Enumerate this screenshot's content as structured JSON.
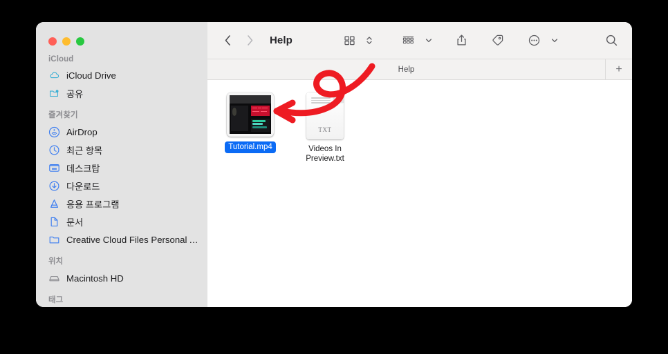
{
  "window": {
    "title": "Help",
    "traffic_lights": [
      "close",
      "minimize",
      "maximize"
    ]
  },
  "sidebar": {
    "sections": [
      {
        "title": "iCloud",
        "items": [
          {
            "label": "iCloud Drive",
            "icon": "icloud-drive-icon"
          },
          {
            "label": "공유",
            "icon": "shared-folder-icon"
          }
        ]
      },
      {
        "title": "즐겨찾기",
        "items": [
          {
            "label": "AirDrop",
            "icon": "airdrop-icon"
          },
          {
            "label": "최근 항목",
            "icon": "recents-clock-icon"
          },
          {
            "label": "데스크탑",
            "icon": "desktop-icon"
          },
          {
            "label": "다운로드",
            "icon": "downloads-icon"
          },
          {
            "label": "응용 프로그램",
            "icon": "applications-icon"
          },
          {
            "label": "문서",
            "icon": "documents-icon"
          },
          {
            "label": "Creative Cloud Files Personal A...",
            "icon": "folder-icon"
          }
        ]
      },
      {
        "title": "위치",
        "items": [
          {
            "label": "Macintosh HD",
            "icon": "hard-disk-icon"
          }
        ]
      }
    ],
    "cut_off_section_title": "태그"
  },
  "toolbar": {
    "back_icon": "chevron-left-icon",
    "forward_icon": "chevron-right-icon",
    "folder_title": "Help",
    "view_icon": "icon-view-grid-icon",
    "view_stepper_icon": "up-down-chevron-icon",
    "group_icon": "group-by-list-icon",
    "group_chevron_icon": "chevron-down-icon",
    "share_icon": "share-icon",
    "tag_icon": "tag-icon",
    "more_icon": "more-ellipsis-circle-icon",
    "more_chevron_icon": "chevron-down-icon",
    "search_icon": "search-icon"
  },
  "tabbar": {
    "active_tab": "Help",
    "add_tab_label": "+"
  },
  "files": [
    {
      "name": "Tutorial.mp4",
      "kind": "video-thumbnail",
      "selected": true
    },
    {
      "name": "Videos In Preview.txt",
      "kind": "text-document",
      "badge": "TXT",
      "selected": false
    }
  ],
  "annotation": {
    "type": "hand-drawn-arrow",
    "color": "#ee1b22",
    "description": "red looping arrow pointing left toward Tutorial.mp4"
  },
  "colors": {
    "accent_selection": "#0b6bf5",
    "sidebar_bg": "#e3e3e3",
    "toolbar_bg": "#f3f2f1",
    "content_bg": "#ffffff",
    "annotation_red": "#ee1b22",
    "icloud_icon": "#3aafd4",
    "favorite_icon": "#3f7ff0",
    "backdrop": "#000000"
  }
}
